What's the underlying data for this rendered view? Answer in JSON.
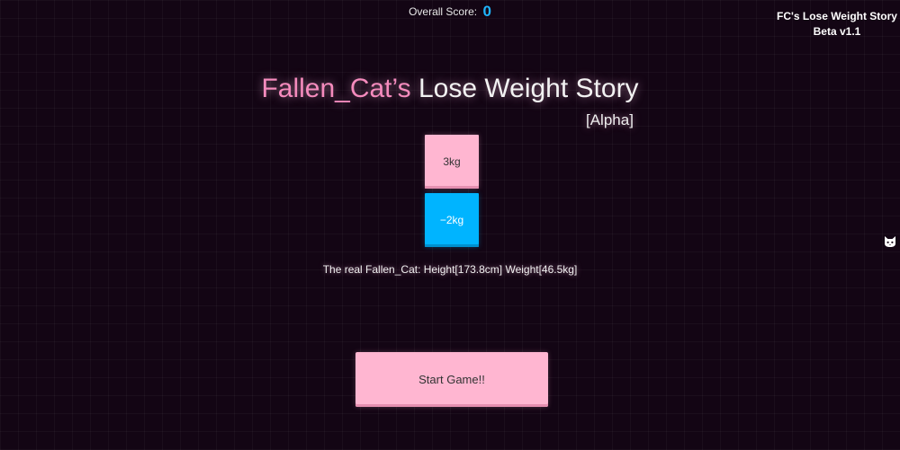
{
  "header": {
    "score_label": "Overall Score:",
    "score_value": "0"
  },
  "version": {
    "line1": "FC's Lose Weight Story",
    "line2": "Beta v1.1"
  },
  "title": {
    "name": "Fallen_Cat’s",
    "rest": "Lose Weight Story",
    "tag": "[Alpha]"
  },
  "blocks": [
    {
      "label": "3kg",
      "color": "#ffb6d1"
    },
    {
      "label": "−2kg",
      "color": "#00b4ff"
    }
  ],
  "info": "The real Fallen_Cat: Height[173.8cm] Weight[46.5kg]",
  "start_button": {
    "label": "Start Game!!"
  },
  "icons": {
    "side": "cat-icon"
  },
  "colors": {
    "background": "#130514",
    "accent_pink": "#f58bbd",
    "block_pink": "#ffb6d1",
    "block_blue": "#00b4ff",
    "score_blue": "#1fb6ff"
  }
}
